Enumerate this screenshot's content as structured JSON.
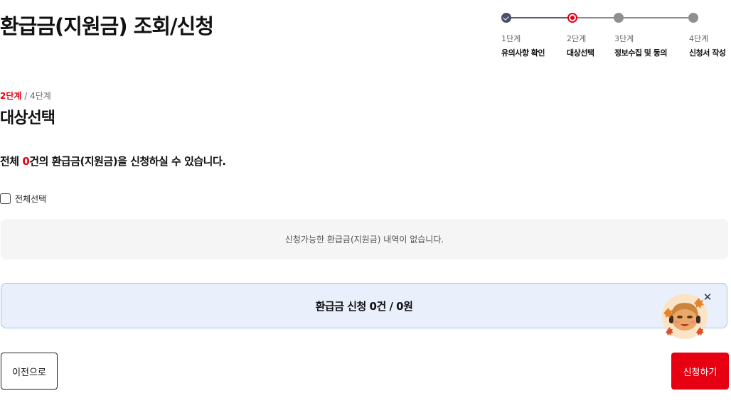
{
  "page": {
    "title": "환급금(지원금) 조회/신청"
  },
  "stepper": {
    "steps": [
      {
        "num": "1단계",
        "name": "유의사항 확인",
        "state": "done"
      },
      {
        "num": "2단계",
        "name": "대상선택",
        "state": "current"
      },
      {
        "num": "3단계",
        "name": "정보수집 및 동의",
        "state": "todo"
      },
      {
        "num": "4단계",
        "name": "신청서 작성",
        "state": "todo"
      }
    ]
  },
  "progress": {
    "current": "2단계",
    "separator": " / ",
    "total": "4단계"
  },
  "section": {
    "title": "대상선택"
  },
  "summary": {
    "prefix": "전체 ",
    "count": "0",
    "suffix": "건의 환급금(지원금)을 신청하실 수 있습니다."
  },
  "select_all": {
    "label": "전체선택",
    "checked": false
  },
  "empty_state": {
    "message": "신청가능한 환급금(지원금) 내역이 없습니다."
  },
  "total": {
    "text": "환급금 신청 0건 / 0원"
  },
  "chatbot": {
    "icon": "chatbot-character-icon",
    "close_icon": "close-icon",
    "close_label": "✕"
  },
  "buttons": {
    "prev_label": "이전으로",
    "apply_label": "신청하기"
  },
  "colors": {
    "accent": "#e60012",
    "step_done": "#4a4e6b",
    "step_todo": "#8f8f8f",
    "total_bg": "#e9f0fb",
    "total_border": "#a9c2e8",
    "empty_bg": "#f5f5f5"
  }
}
